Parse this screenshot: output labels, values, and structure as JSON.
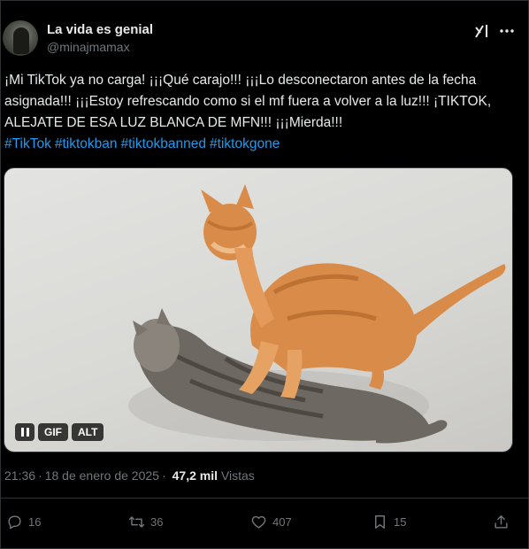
{
  "author": {
    "name": "La vida es genial",
    "handle": "@minajmamax"
  },
  "icons": {
    "grok": "grok-icon",
    "more": "more-icon",
    "reply": "reply-icon",
    "repost": "repost-icon",
    "like": "heart-icon",
    "bookmark": "bookmark-icon",
    "share": "share-icon",
    "pause": "pause-icon"
  },
  "tweet": {
    "text": "¡Mi TikTok ya no carga! ¡¡¡Qué carajo!!! ¡¡¡Lo desconectaron antes de la fecha asignada!!! ¡¡¡Estoy refrescando como si el mf fuera a volver a la luz!!! ¡TIKTOK, ALEJATE DE ESA LUZ BLANCA DE MFN!!! ¡¡¡Mierda!!!",
    "hashtags": [
      "#TikTok",
      "#tiktokban",
      "#tiktokbanned",
      "#tiktokgone"
    ]
  },
  "media": {
    "gif_label": "GIF",
    "alt_label": "ALT"
  },
  "meta": {
    "time": "21:36",
    "separator": "·",
    "date": "18 de enero de 2025",
    "views_count": "47,2 mil",
    "views_label": "Vistas"
  },
  "actions": {
    "replies": "16",
    "reposts": "36",
    "likes": "407",
    "bookmarks": "15"
  },
  "colors": {
    "background": "#000000",
    "text": "#e7e9ea",
    "secondary": "#71767b",
    "link": "#1d9bf0",
    "border": "#2f3336"
  }
}
